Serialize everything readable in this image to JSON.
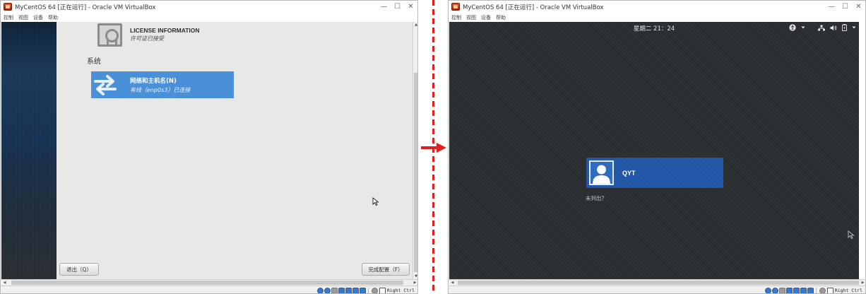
{
  "left_window": {
    "title": "MyCentOS 64 [正在运行] - Oracle VM VirtualBox",
    "menu": [
      "控制",
      "视图",
      "设备",
      "帮助"
    ],
    "guest": {
      "license": {
        "title": "LICENSE INFORMATION",
        "subtitle": "许可证已接受"
      },
      "section_heading": "系统",
      "network": {
        "title": "网络和主机名(N)",
        "subtitle": "有线（enp0s3）已连接"
      },
      "quit_label": "退出（Q）",
      "finish_label": "完成配置（F）"
    },
    "status": {
      "host_key": "Right Ctrl"
    }
  },
  "right_window": {
    "title": "MyCentOS 64 [正在运行] - Oracle VM VirtualBox",
    "menu": [
      "控制",
      "视图",
      "设备",
      "帮助"
    ],
    "guest": {
      "clock": "星期二 21：24",
      "user_name": "QYT",
      "not_listed": "未列出？"
    },
    "status": {
      "host_key": "Right Ctrl"
    }
  },
  "window_controls": {
    "minimize": "—",
    "maximize": "☐",
    "close": "✕"
  },
  "colors": {
    "network_tile": "#4a90d9",
    "user_tile": "#2158a8",
    "login_background": "#2b2f32",
    "divider": "#e02020"
  },
  "icons": {
    "network": "network-arrows-icon",
    "license": "certificate-icon",
    "avatar": "user-avatar-icon",
    "accessibility": "accessibility-icon",
    "network_tray": "network-wired-icon",
    "volume": "volume-icon",
    "battery": "battery-icon",
    "power_menu": "chevron-down-icon"
  }
}
